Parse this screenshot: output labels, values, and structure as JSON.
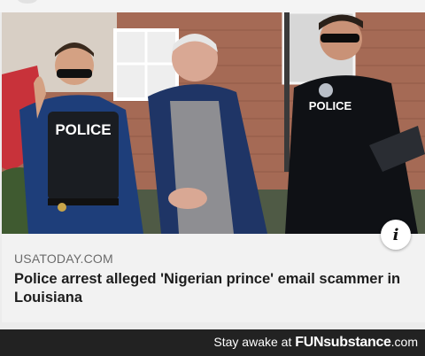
{
  "article": {
    "source": "USATODAY.COM",
    "headline": "Police arrest alleged 'Nigerian prince' email scammer in Louisiana",
    "photo": {
      "vest_left_label": "POLICE",
      "vest_right_label": "POLICE"
    },
    "info_icon": "i"
  },
  "footer": {
    "tagline": "Stay awake at",
    "brand_prefix": "FUN",
    "brand_suffix": "substance",
    "brand_tld": ".com"
  },
  "colors": {
    "uniform": "#1f2a3a",
    "brick": "#8a4a3a",
    "sky_wall": "#c9b7a6",
    "footer_bg": "#222222"
  }
}
